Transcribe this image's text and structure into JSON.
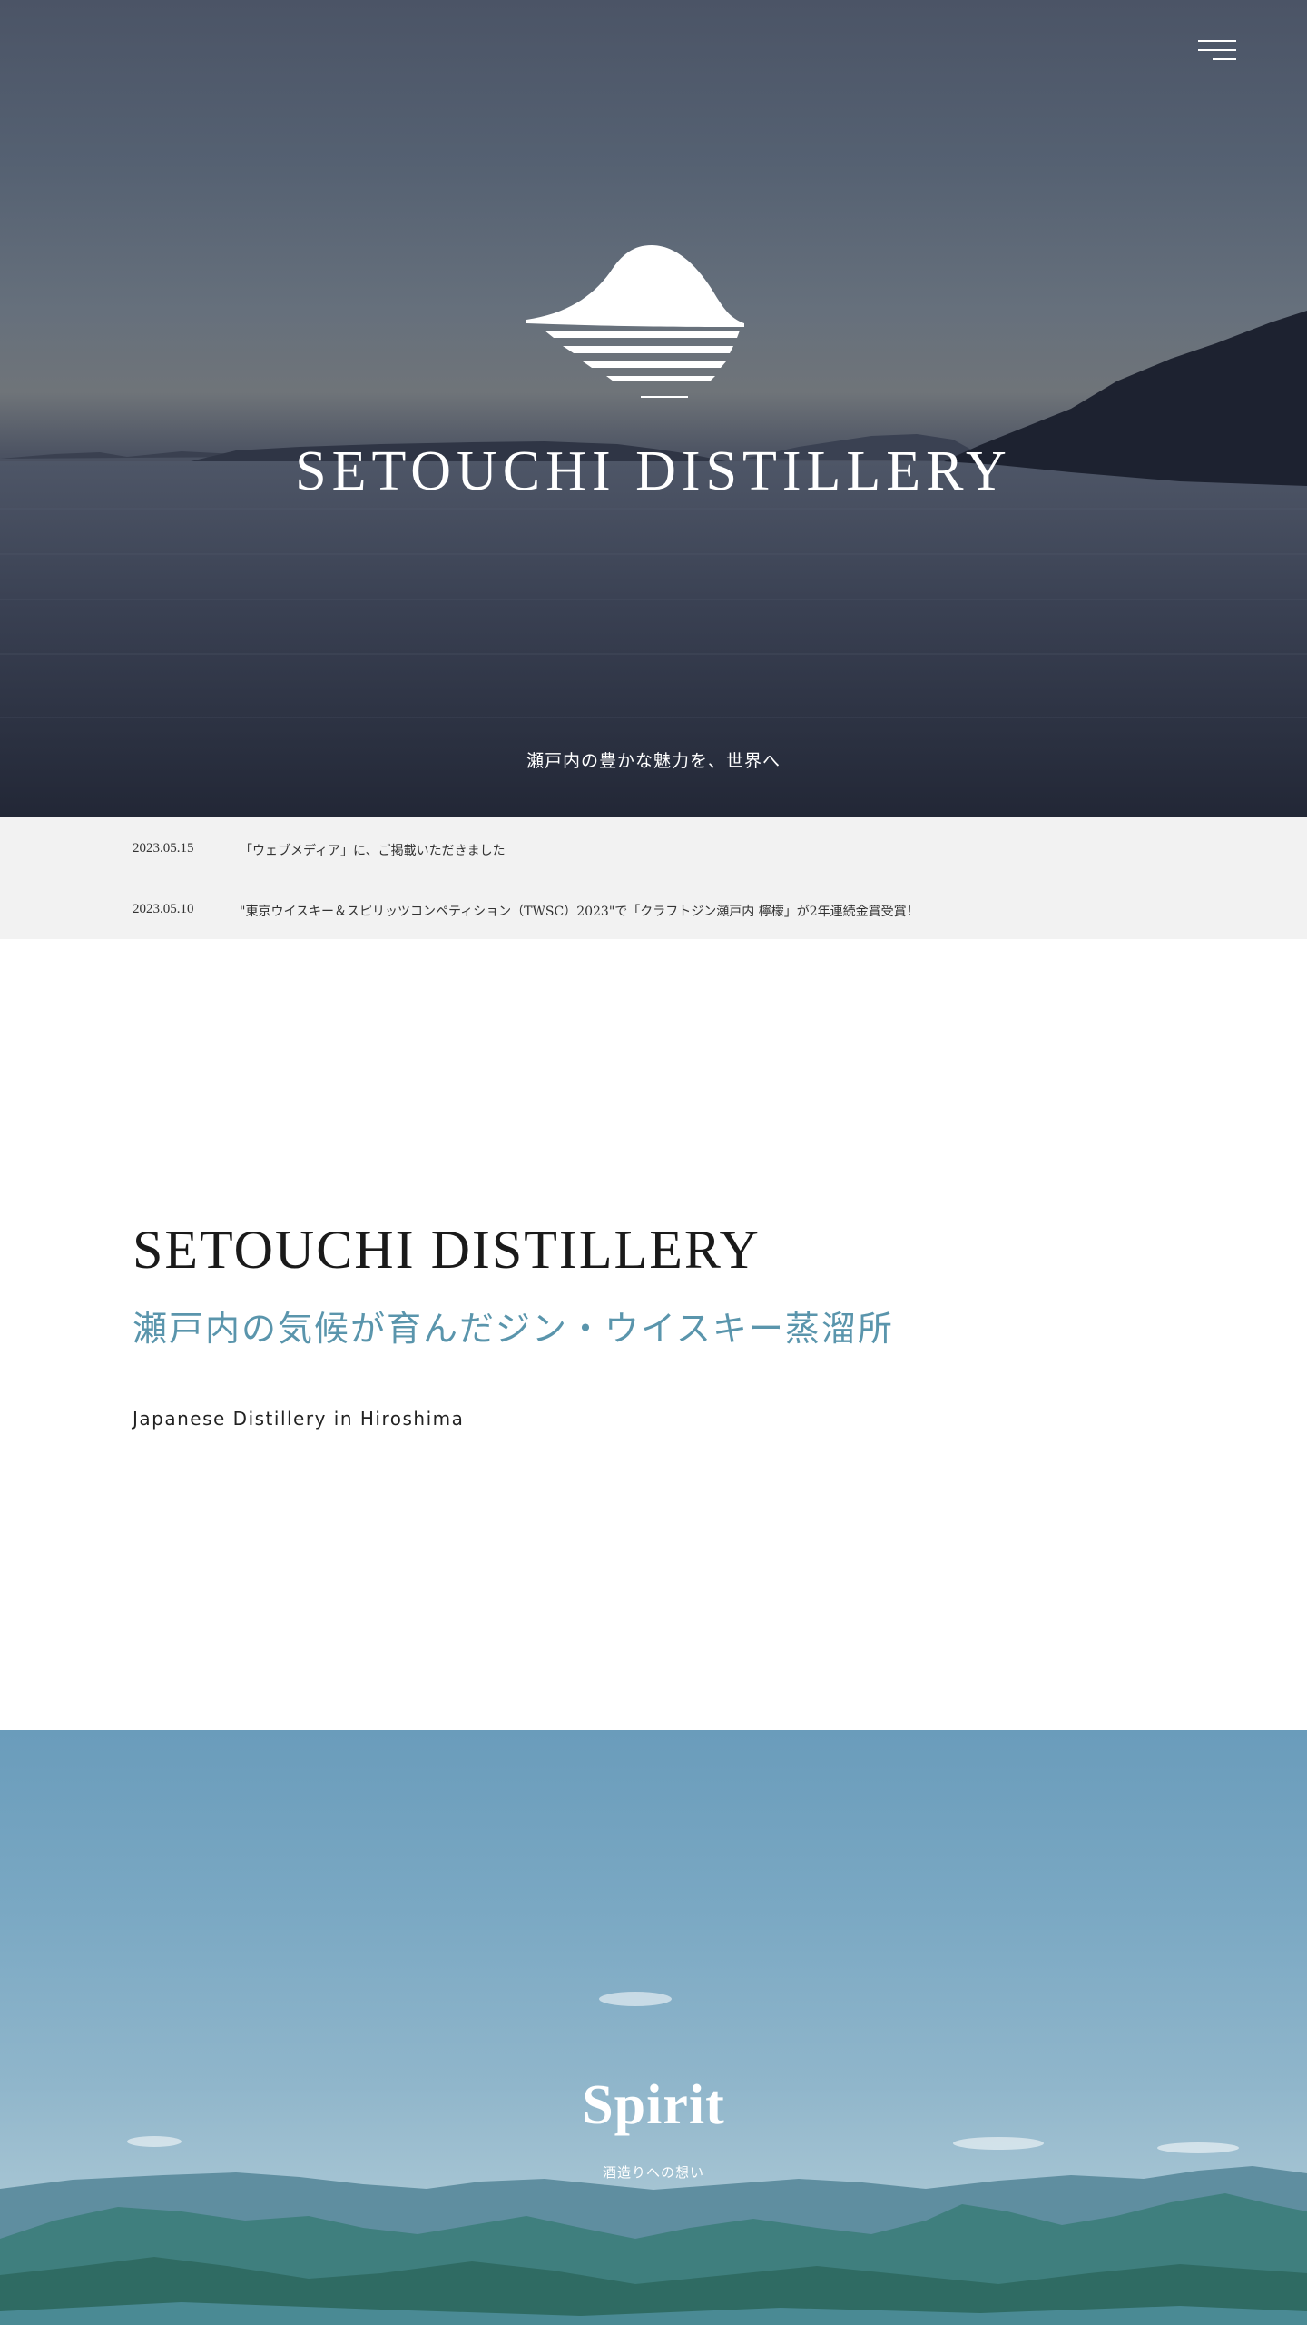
{
  "hero": {
    "title": "SETOUCHI DISTILLERY",
    "tagline": "瀬戸内の豊かな魅力を、世界へ",
    "menu_icon": "hamburger-menu-icon",
    "logo_icon": "island-sun-logo-icon"
  },
  "news": {
    "items": [
      {
        "date": "2023.05.15",
        "title": "「ウェブメディア」に、ご掲載いただきました"
      },
      {
        "date": "2023.05.10",
        "title": "\"東京ウイスキー＆スピリッツコンペティション（TWSC）2023\"で「クラフトジン瀬戸内 檸檬」が2年連続金賞受賞！"
      }
    ]
  },
  "intro": {
    "title": "SETOUCHI DISTILLERY",
    "subtitle": "瀬戸内の気候が育んだジン・ウイスキー蒸溜所",
    "caption": "Japanese Distillery in Hiroshima"
  },
  "spirit": {
    "title": "Spirit",
    "subtitle": "酒造りへの想い"
  },
  "colors": {
    "accent": "#5a95ac",
    "news_bg": "#f2f2f2",
    "text": "#1a1a1a"
  }
}
